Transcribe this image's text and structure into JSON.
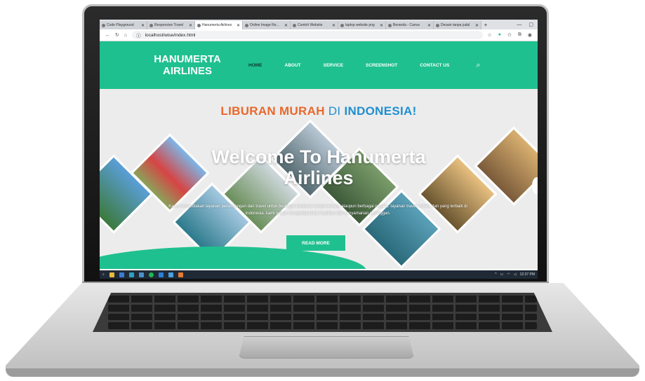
{
  "browser": {
    "tabs": [
      {
        "label": "Code Playground",
        "icon": "code-icon",
        "active": false
      },
      {
        "label": "Responsive Travel",
        "icon": "chrome-icon",
        "active": false
      },
      {
        "label": "Hanumerta Airlines",
        "icon": "page-icon",
        "active": true
      },
      {
        "label": "Online Image Re...",
        "icon": "page-icon",
        "active": false
      },
      {
        "label": "Contoh Website",
        "icon": "site-icon",
        "active": false
      },
      {
        "label": "laptop website png",
        "icon": "bing-icon",
        "active": false
      },
      {
        "label": "Beranda - Canva",
        "icon": "canva-icon",
        "active": false
      },
      {
        "label": "Desain tanpa judul",
        "icon": "canva-icon",
        "active": false
      }
    ],
    "url": "localhost/wise/index.html"
  },
  "site": {
    "brand_line1": "HANUMERTA",
    "brand_line2": "AIRLINES",
    "menu": [
      "HOME",
      "ABOUT",
      "SERVICE",
      "SCREENSHOT",
      "CONTACT US"
    ],
    "banner_part1": "LIBURAN MURAH",
    "banner_part2": "DI",
    "banner_part3": "INDONESIA!",
    "welcome": "Welcome To Hanumerta Airlines",
    "description": "Kami menyediakan layanan penerbangan dan travel untuk berbagai destinasi tempat wisata ataupun berbagai negara. layanan travel terbaik dan yang terbaik di Indonesia. kami selalu mengedepankan kualitas dan kenyamanan pelanggan.",
    "cta": "READ MORE",
    "accent": "#1fc08f"
  },
  "taskbar": {
    "time": "12:37 PM"
  }
}
